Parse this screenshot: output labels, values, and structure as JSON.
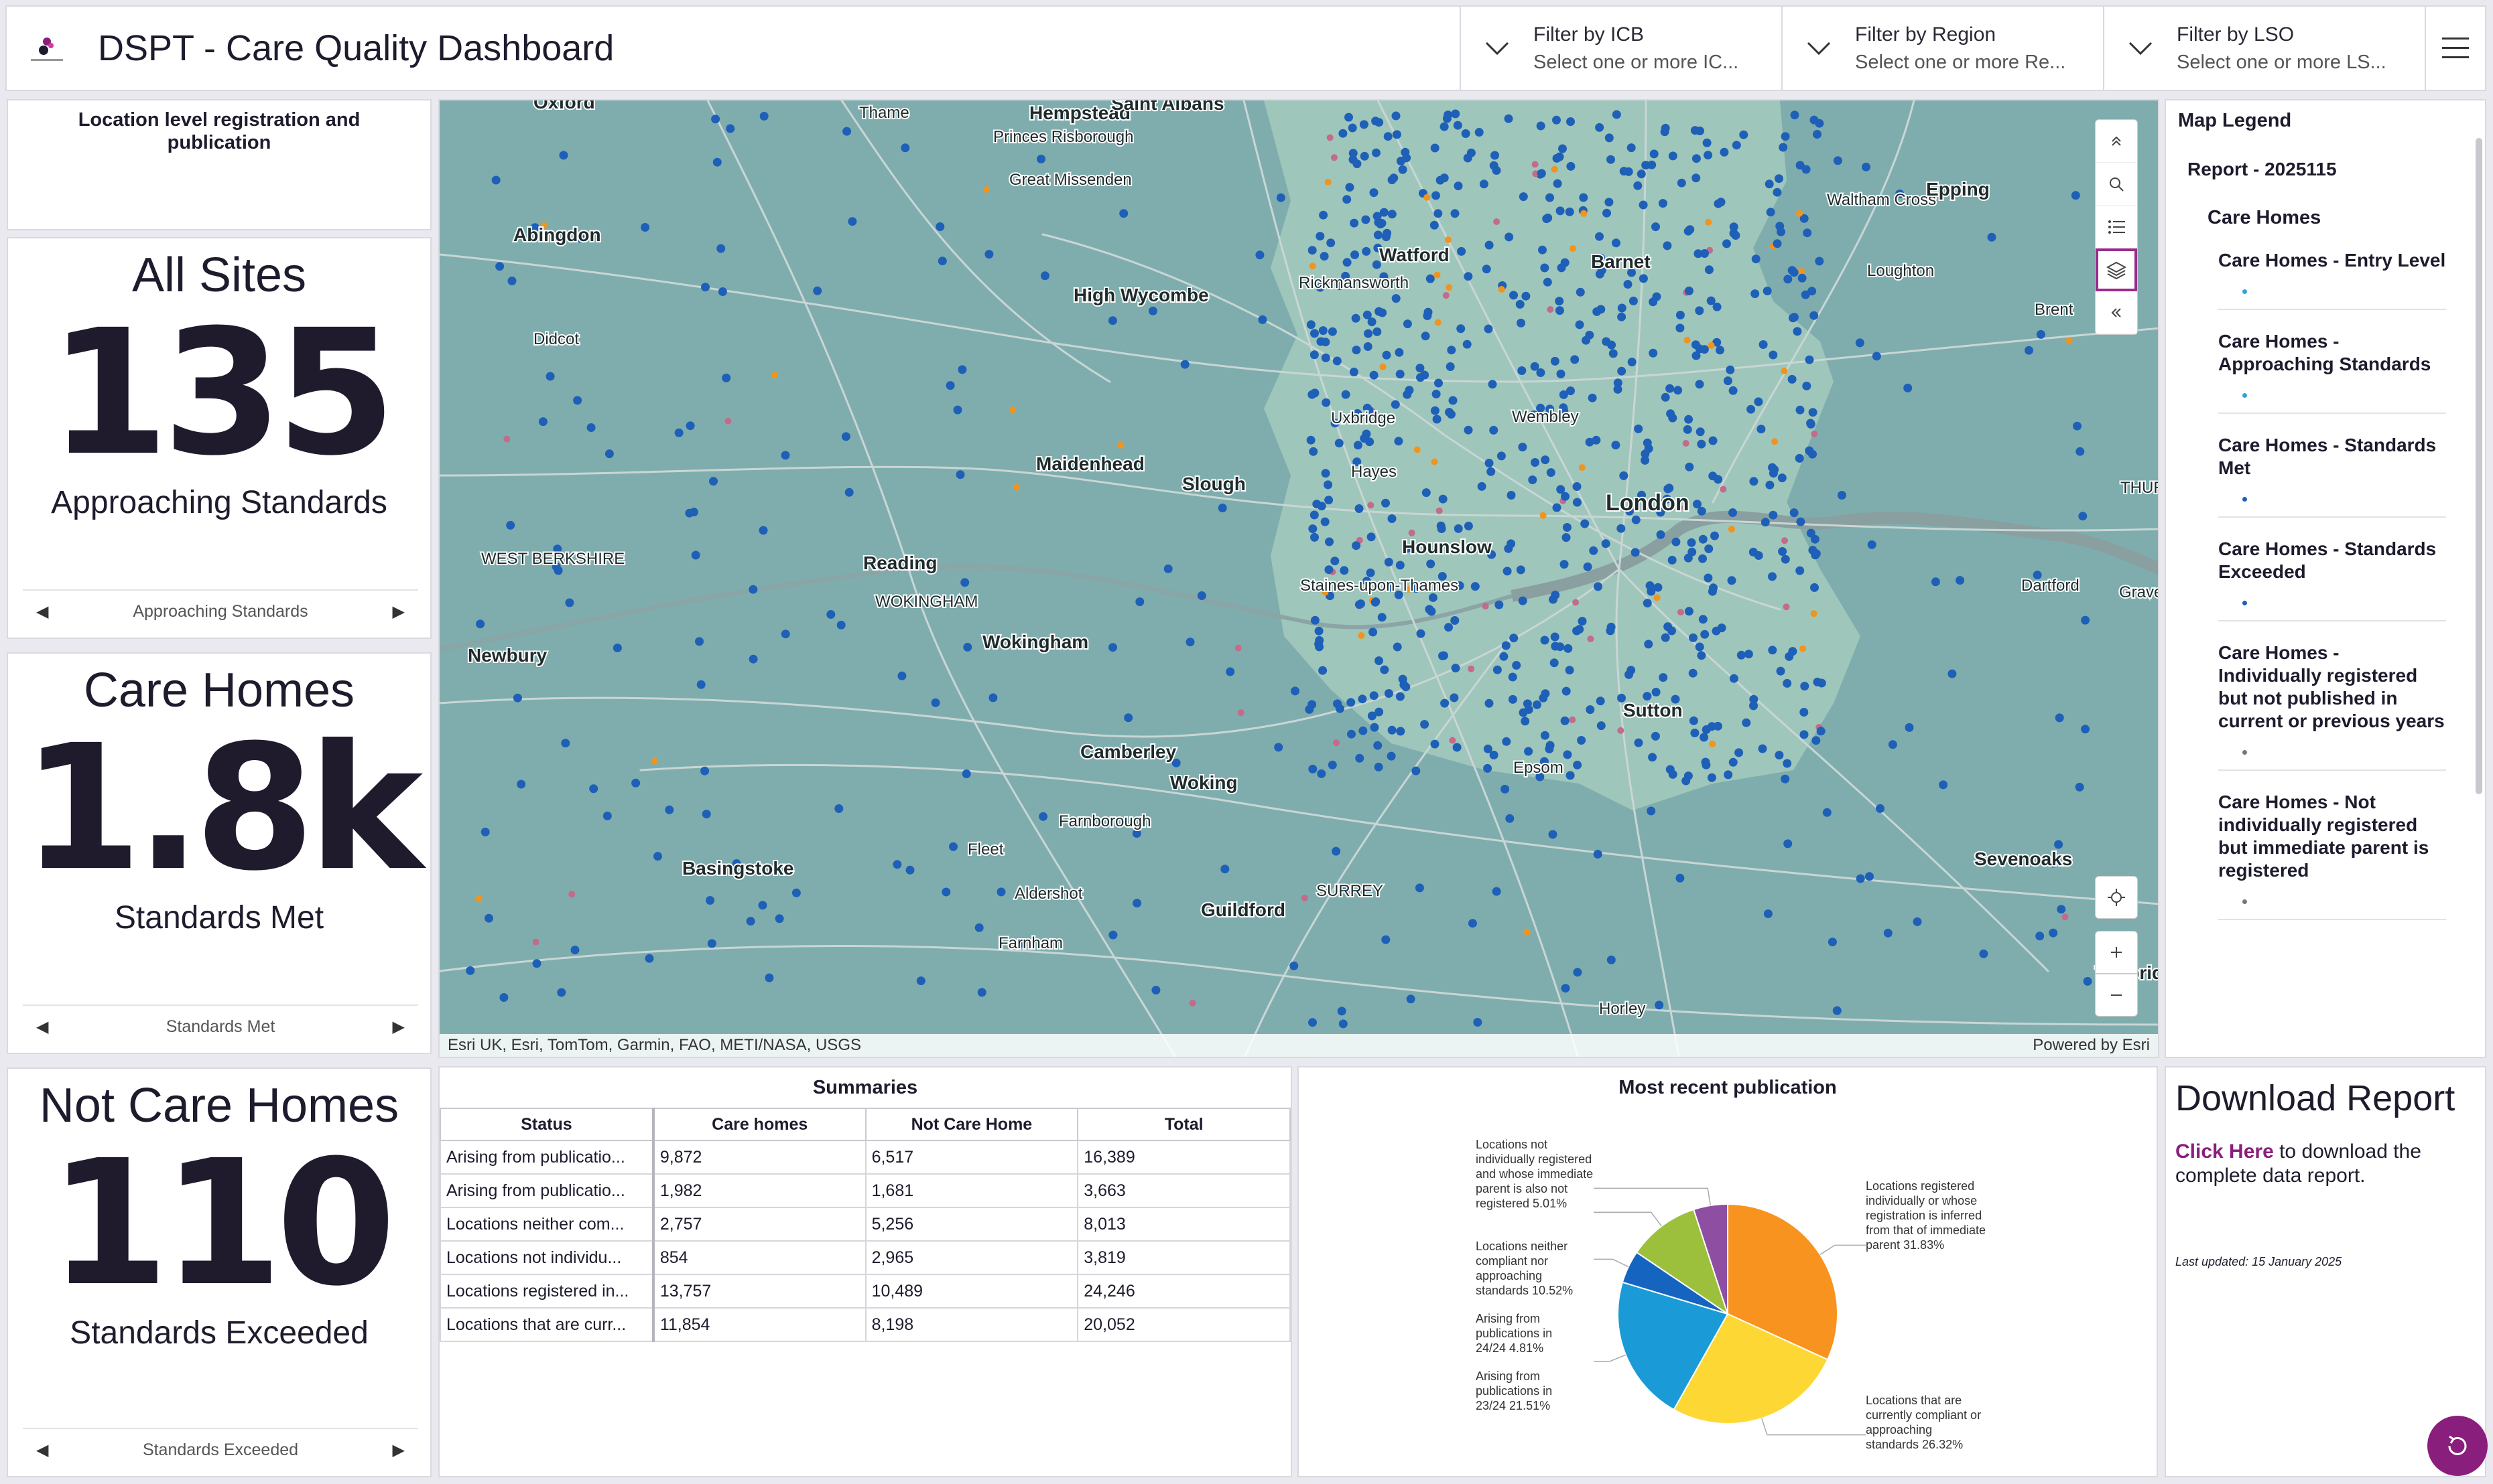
{
  "header": {
    "title": "DSPT - Care Quality Dashboard",
    "filters": [
      {
        "title": "Filter by ICB",
        "placeholder": "Select one or more IC..."
      },
      {
        "title": "Filter by Region",
        "placeholder": "Select one or more Re..."
      },
      {
        "title": "Filter by LSO",
        "placeholder": "Select one or more LS..."
      }
    ]
  },
  "location_panel": {
    "title": "Location level registration and publication"
  },
  "kpis": [
    {
      "title": "All Sites",
      "value": "135",
      "subtitle": "Approaching Standards",
      "nav_label": "Approaching Standards"
    },
    {
      "title": "Care Homes",
      "value": "1.8k",
      "subtitle": "Standards Met",
      "nav_label": "Standards Met"
    },
    {
      "title": "Not Care Homes",
      "value": "110",
      "subtitle": "Standards Exceeded",
      "nav_label": "Standards Exceeded"
    }
  ],
  "map": {
    "places": [
      "Oxford",
      "Thame",
      "Princes Risborough",
      "Hempstead",
      "Saint Albans",
      "Abingdon",
      "Great Missenden",
      "Waltham Cross",
      "Epping",
      "Watford",
      "Barnet",
      "Loughton",
      "High Wycombe",
      "Rickmansworth",
      "Brent",
      "Didcot",
      "Wembley",
      "Uxbridge",
      "Maidenhead",
      "Hayes",
      "Slough",
      "London",
      "THUR",
      "Hounslow",
      "WEST BERKSHIRE",
      "Reading",
      "WOKINGHAM",
      "Wokingham",
      "Staines-upon-Thames",
      "Dartford",
      "Grave",
      "Newbury",
      "Camberley",
      "Sutton",
      "Epsom",
      "Woking",
      "Farnborough",
      "Fleet",
      "Basingstoke",
      "Sevenoaks",
      "Aldershot",
      "Guildford",
      "SURREY",
      "Farnham",
      "Tonbrid",
      "Horley"
    ],
    "attribution": "Esri UK, Esri, TomTom, Garmin, FAO, METI/NASA, USGS",
    "powered_by": "Powered by Esri",
    "land_color": "#7fadae",
    "london_color": "#9fc6bb",
    "point_colors": {
      "standards_met": "#1e5fb8",
      "approaching": "#f0941e",
      "not_published": "#c46a8a"
    }
  },
  "legend": {
    "title": "Map Legend",
    "report": "Report - 2025115",
    "category": "Care Homes",
    "items": [
      {
        "label": "Care Homes - Entry Level",
        "color": "#2aa7d8"
      },
      {
        "label": "Care Homes - Approaching Standards",
        "color": "#2aa7d8"
      },
      {
        "label": "Care Homes - Standards Met",
        "color": "#1e5fb8"
      },
      {
        "label": "Care Homes - Standards Exceeded",
        "color": "#1e5fb8"
      },
      {
        "label": "Care Homes - Individually registered but not published in current or previous years",
        "color": "#777777"
      },
      {
        "label": "Care Homes - Not individually registered but immediate parent is registered",
        "color": "#777777"
      }
    ]
  },
  "summaries": {
    "title": "Summaries",
    "columns": [
      "Status",
      "Care homes",
      "Not Care Home",
      "Total"
    ],
    "rows": [
      [
        "Arising from publicatio...",
        "9,872",
        "6,517",
        "16,389"
      ],
      [
        "Arising from publicatio...",
        "1,982",
        "1,681",
        "3,663"
      ],
      [
        "Locations neither com...",
        "2,757",
        "5,256",
        "8,013"
      ],
      [
        "Locations not individu...",
        "854",
        "2,965",
        "3,819"
      ],
      [
        "Locations registered in...",
        "13,757",
        "10,489",
        "24,246"
      ],
      [
        "Locations that are curr...",
        "11,854",
        "8,198",
        "20,052"
      ]
    ]
  },
  "chart_data": {
    "type": "pie",
    "title": "Most recent publication",
    "slices": [
      {
        "label": "Locations registered individually or whose registration is inferred from that of immediate parent 31.83%",
        "value": 31.83,
        "color": "#f7931e"
      },
      {
        "label": "Locations that are currently compliant or approaching standards 26.32%",
        "value": 26.32,
        "color": "#fdd835"
      },
      {
        "label": "Arising from publications in 23/24 21.51%",
        "value": 21.51,
        "color": "#1a9bd7"
      },
      {
        "label": "Arising from publications in 24/24 4.81%",
        "value": 4.81,
        "color": "#1565c0"
      },
      {
        "label": "Locations neither compliant nor approaching standards 10.52%",
        "value": 10.52,
        "color": "#9cc03b"
      },
      {
        "label": "Locations not individually registered and whose immediate parent is also not registered 5.01%",
        "value": 5.01,
        "color": "#8e4fa3"
      }
    ]
  },
  "download": {
    "title": "Download Report",
    "link_text": "Click Here",
    "body_text": " to download the complete data report.",
    "updated": "Last updated: 15 January 2025"
  }
}
